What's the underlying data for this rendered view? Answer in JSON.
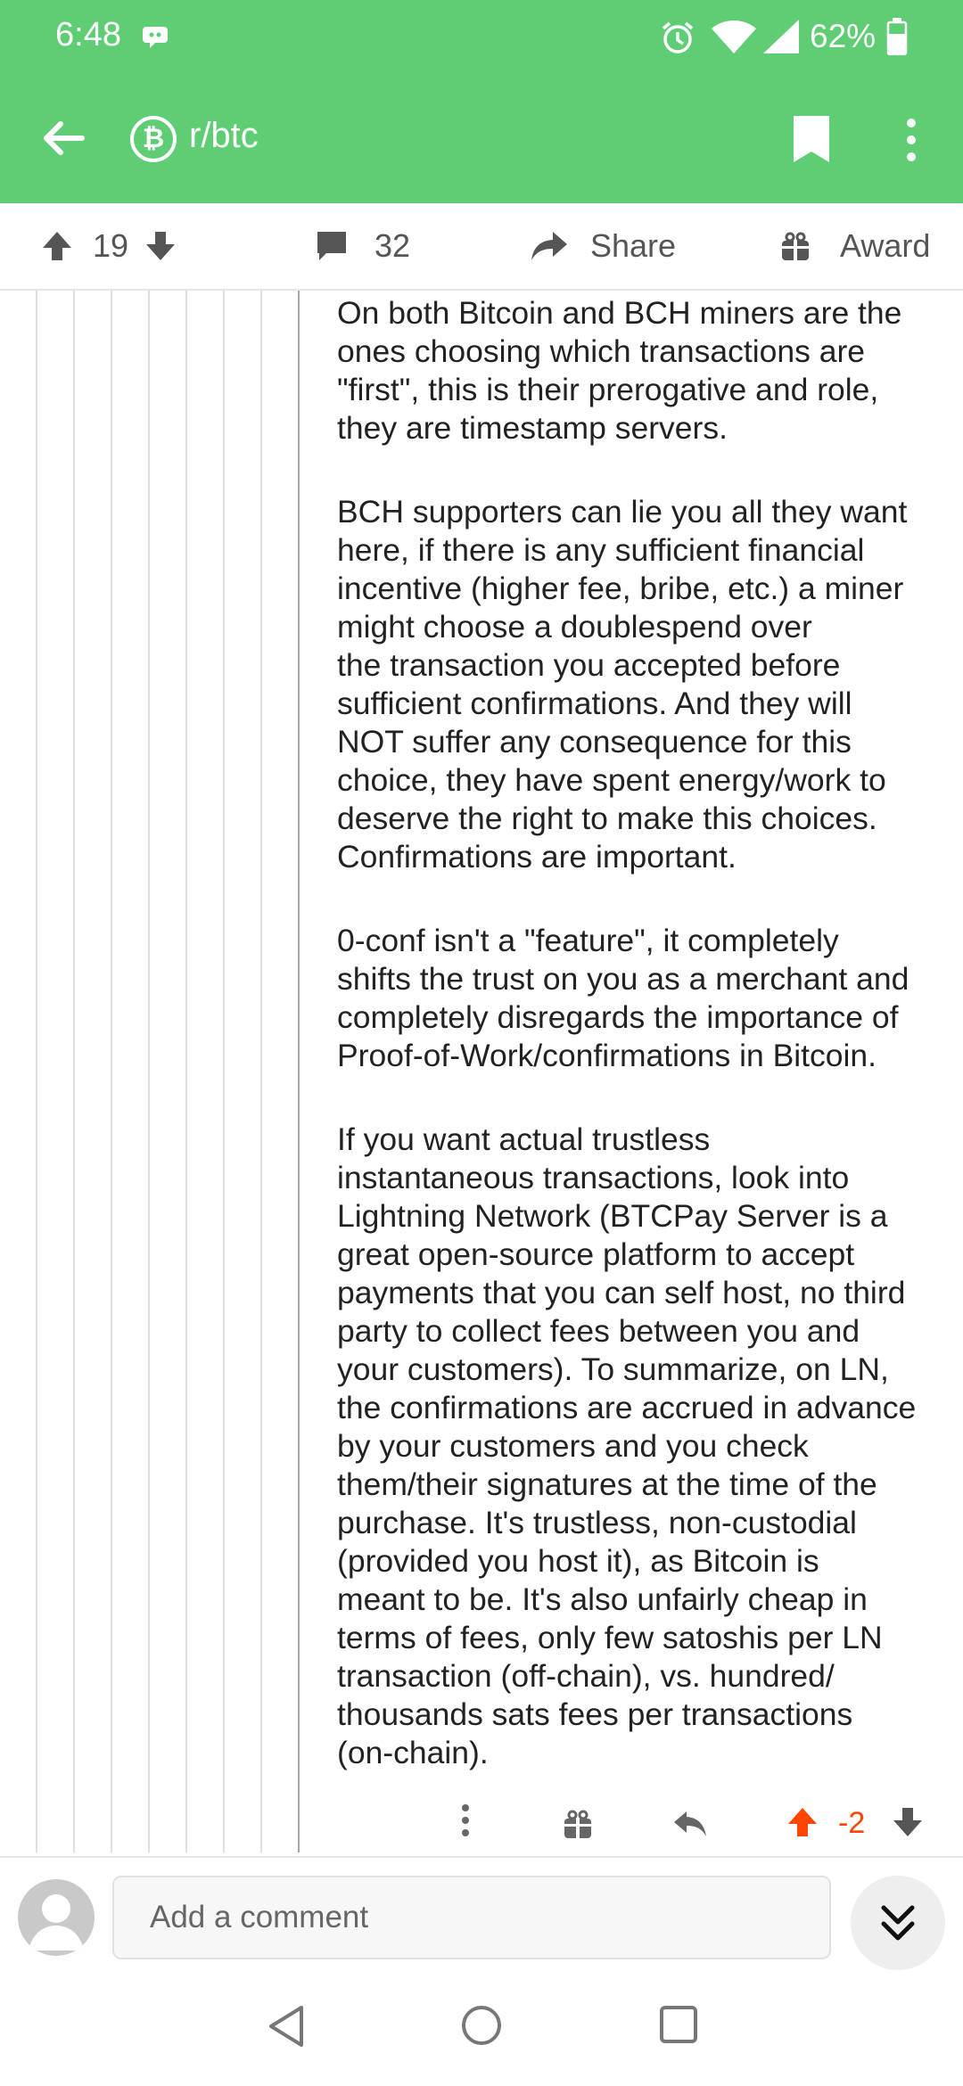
{
  "status_bar": {
    "time": "6:48",
    "battery": "62%"
  },
  "app_bar": {
    "subreddit": "r/btc",
    "sub_icon_letter": "₿"
  },
  "post_actions": {
    "upvotes": "19",
    "comments": "32",
    "share_label": "Share",
    "award_label": "Award"
  },
  "comment": {
    "paragraphs": [
      "On both Bitcoin and BCH miners are the\nones choosing which transactions are\n\"first\", this is their prerogative and role,\nthey are timestamp servers.",
      "BCH supporters can lie you all they want\nhere, if there is any sufficient financial\nincentive (higher fee, bribe, etc.) a miner\nmight choose a doublespend over\nthe transaction you accepted before\nsufficient confirmations. And they will\nNOT suffer any consequence for this\nchoice, they have spent energy/work to\ndeserve the right to make this choices.\nConfirmations are important.",
      "0-conf isn't a \"feature\", it completely\nshifts the trust on you as a merchant and\ncompletely disregards the importance of\nProof-of-Work/confirmations in Bitcoin.",
      "If you want actual trustless\ninstantaneous transactions, look into\nLightning Network (BTCPay Server is a\ngreat open-source platform to accept\npayments that you can self host, no third\nparty to collect fees between you and\nyour customers). To summarize, on LN,\nthe confirmations are accrued in advance\nby your customers and you check\nthem/their signatures at the time of the\npurchase. It's trustless, non-custodial\n(provided you host it), as Bitcoin is\nmeant to be. It's also unfairly cheap in\nterms of fees, only few satoshis per LN\ntransaction (off-chain), vs. hundred/\nthousands sats fees per transactions\n(on-chain)."
    ],
    "score": "-2"
  },
  "composer": {
    "placeholder": "Add a comment"
  },
  "colors": {
    "accent": "#5fcd74",
    "upvote": "#ff4500"
  }
}
